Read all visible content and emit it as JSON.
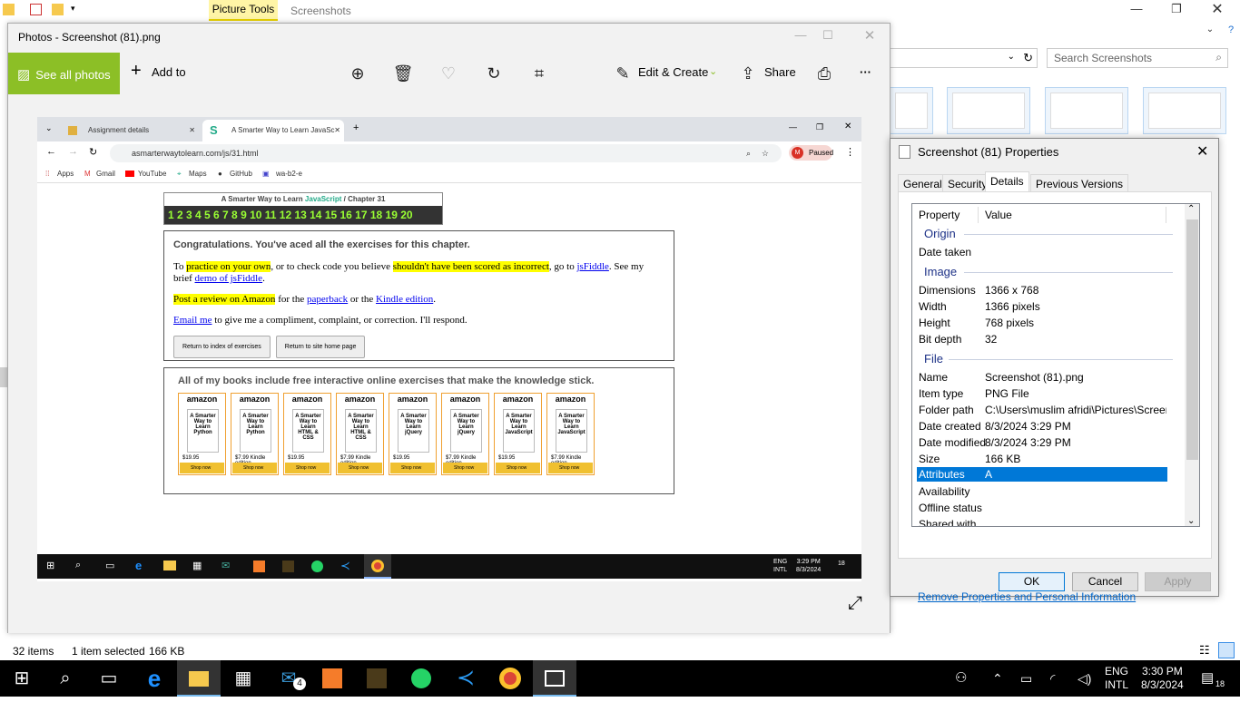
{
  "explorer": {
    "ribbon_context_tab": "Picture Tools",
    "window_title": "Screenshots",
    "search_placeholder": "Search Screenshots",
    "status_items": "32 items",
    "status_selected": "1 item selected",
    "status_size": "166 KB"
  },
  "photos": {
    "title": "Photos - Screenshot (81).png",
    "see_all": "See all photos",
    "add_to": "Add to",
    "edit_create": "Edit & Create",
    "share": "Share",
    "more": "···"
  },
  "inner": {
    "tab1": "Assignment details",
    "tab2": "A Smarter Way to Learn JavaSc",
    "url": "asmarterwaytolearn.com/js/31.html",
    "paused": "Paused",
    "bookmarks": [
      "Apps",
      "Gmail",
      "YouTube",
      "Maps",
      "GitHub",
      "wa-b2-e"
    ],
    "chapter_title_a": "A Smarter Way to Learn",
    "chapter_title_b": "JavaScript",
    "chapter_title_c": "/ Chapter 31",
    "chapter_numbers": "1 2 3 4 5 6 7 8 9 10 11 12 13 14 15 16 17 18 19 20",
    "congrats_heading": "Congratulations. You've aced all the exercises for this chapter.",
    "p1_a": "To ",
    "p1_hl1": "practice on your own",
    "p1_b": ", or to check code you believe ",
    "p1_hl2": "shouldn't have been scored as incorrect",
    "p1_c": ", go to ",
    "p1_link1": "jsFiddle",
    "p1_d": ". See my brief ",
    "p1_link2": "demo of jsFiddle",
    "p1_e": ".",
    "p2_hl": "Post a review on Amazon",
    "p2_a": " for the ",
    "p2_link1": "paperback",
    "p2_b": " or the ",
    "p2_link2": "Kindle edition",
    "p2_c": ".",
    "p3_link": "Email me",
    "p3_a": " to give me a compliment, complaint, or correction. I'll respond.",
    "btn_index": "Return to index of exercises",
    "btn_home": "Return to site home page",
    "books_heading": "All of my books include free interactive online exercises that make the knowledge stick.",
    "books": [
      {
        "brand": "amazon",
        "cover": "A Smarter Way to Learn Python",
        "price": "$19.95",
        "shop": "Shop now"
      },
      {
        "brand": "amazon",
        "cover": "A Smarter Way to Learn Python",
        "price": "$7.99 Kindle edition",
        "shop": "Shop now"
      },
      {
        "brand": "amazon",
        "cover": "A Smarter Way to Learn HTML & CSS",
        "price": "$19.95",
        "shop": "Shop now"
      },
      {
        "brand": "amazon",
        "cover": "A Smarter Way to Learn HTML & CSS",
        "price": "$7.99 Kindle edition",
        "shop": "Shop now"
      },
      {
        "brand": "amazon",
        "cover": "A Smarter Way to Learn jQuery",
        "price": "$19.95",
        "shop": "Shop now"
      },
      {
        "brand": "amazon",
        "cover": "A Smarter Way to Learn jQuery",
        "price": "$7.99 Kindle edition",
        "shop": "Shop now"
      },
      {
        "brand": "amazon",
        "cover": "A Smarter Way to Learn JavaScript",
        "price": "$19.95",
        "shop": "Shop now"
      },
      {
        "brand": "amazon",
        "cover": "A Smarter Way to Learn JavaScript",
        "price": "$7.99 Kindle edition",
        "shop": "Shop now"
      }
    ],
    "tray_lang": "ENG",
    "tray_layout": "INTL",
    "tray_time": "3:29 PM",
    "tray_date": "8/3/2024",
    "tray_notif": "18"
  },
  "props": {
    "title": "Screenshot (81) Properties",
    "tabs": [
      "General",
      "Security",
      "Details",
      "Previous Versions"
    ],
    "col_property": "Property",
    "col_value": "Value",
    "sections": {
      "origin": "Origin",
      "image": "Image",
      "file": "File"
    },
    "rows": {
      "date_taken": {
        "k": "Date taken",
        "v": ""
      },
      "dimensions": {
        "k": "Dimensions",
        "v": "1366 x 768"
      },
      "width": {
        "k": "Width",
        "v": "1366 pixels"
      },
      "height": {
        "k": "Height",
        "v": "768 pixels"
      },
      "bit_depth": {
        "k": "Bit depth",
        "v": "32"
      },
      "name": {
        "k": "Name",
        "v": "Screenshot (81).png"
      },
      "item_type": {
        "k": "Item type",
        "v": "PNG File"
      },
      "folder_path": {
        "k": "Folder path",
        "v": "C:\\Users\\muslim afridi\\Pictures\\Screen..."
      },
      "date_created": {
        "k": "Date created",
        "v": "8/3/2024 3:29 PM"
      },
      "date_modified": {
        "k": "Date modified",
        "v": "8/3/2024 3:29 PM"
      },
      "size": {
        "k": "Size",
        "v": "166 KB"
      },
      "attributes": {
        "k": "Attributes",
        "v": "A"
      },
      "availability": {
        "k": "Availability",
        "v": ""
      },
      "offline_status": {
        "k": "Offline status",
        "v": ""
      },
      "shared_with": {
        "k": "Shared with",
        "v": ""
      }
    },
    "remove_link": "Remove Properties and Personal Information",
    "ok": "OK",
    "cancel": "Cancel",
    "apply": "Apply"
  },
  "taskbar": {
    "lang": "ENG",
    "layout": "INTL",
    "time": "3:30 PM",
    "date": "8/3/2024",
    "notif_count": "18",
    "mail_badge": "4"
  },
  "colors": {
    "photos_accent": "#8cbf26",
    "selection": "#0078d7",
    "picture_tools": "#fff5a6"
  }
}
